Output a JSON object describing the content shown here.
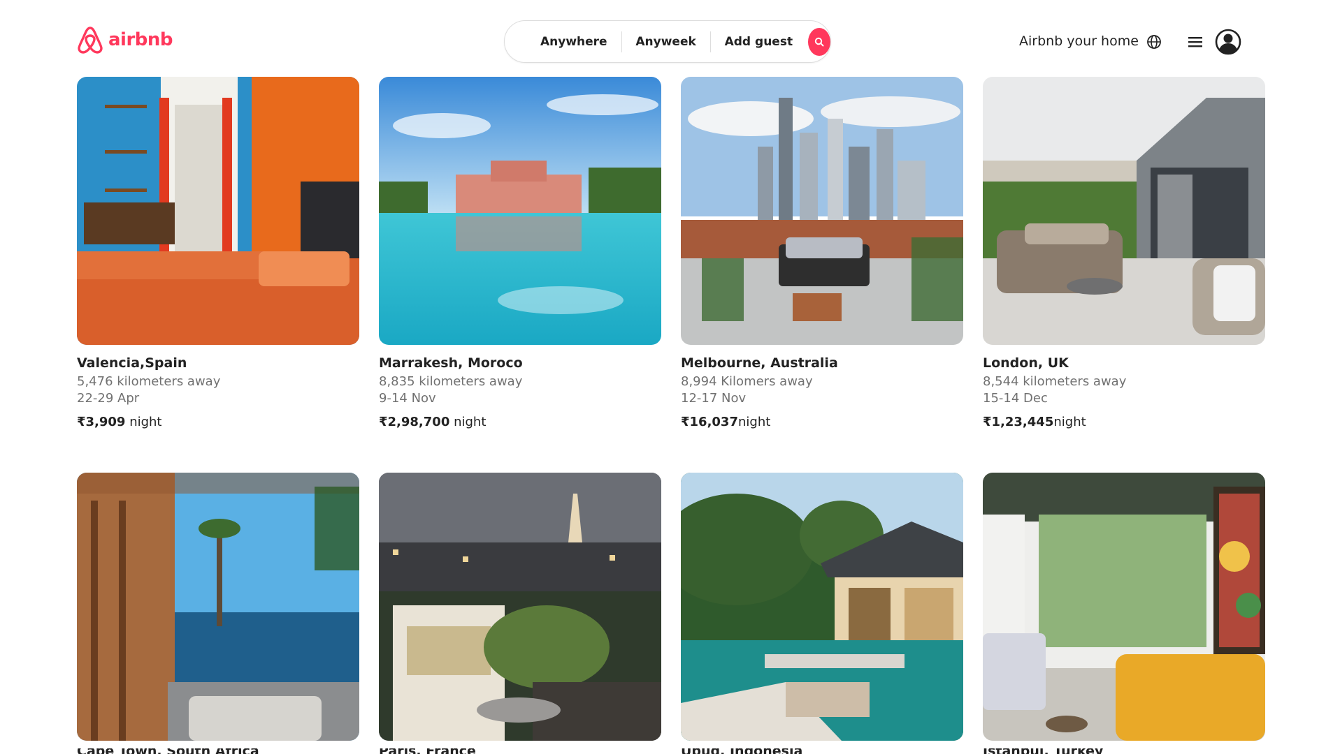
{
  "header": {
    "logo_text": "airbnb",
    "search": {
      "anywhere": "Anywhere",
      "anyweek": "Anyweek",
      "add_guest": "Add guest"
    },
    "host_link": "Airbnb your home",
    "icons": [
      "airbnb-logo-icon",
      "search-icon",
      "globe-icon",
      "menu-icon",
      "avatar-icon"
    ]
  },
  "colors": {
    "brand": "#ff385c",
    "text": "#222222",
    "muted": "#717171"
  },
  "listings": [
    {
      "title": "Valencia,Spain",
      "distance": "5,476 kilometers away",
      "dates": "22-29 Apr",
      "price": "₹3,909",
      "price_suffix": " night"
    },
    {
      "title": "Marrakesh, Moroco",
      "distance": "8,835 kilometers away",
      "dates": "9-14 Nov",
      "price": "₹2,98,700",
      "price_suffix": " night"
    },
    {
      "title": "Melbourne, Australia",
      "distance": "8,994 Kilomers away",
      "dates": "12-17 Nov",
      "price": "₹16,037",
      "price_suffix": "night"
    },
    {
      "title": "London, UK",
      "distance": "8,544 kilometers away",
      "dates": "15-14 Dec",
      "price": "₹1,23,445",
      "price_suffix": "night"
    }
  ],
  "listings_row2": [
    {
      "title": "Cape Town, South Africa"
    },
    {
      "title": "Paris, France"
    },
    {
      "title": "Ubud, Indonesia"
    },
    {
      "title": "Istanbul, Turkey"
    }
  ]
}
